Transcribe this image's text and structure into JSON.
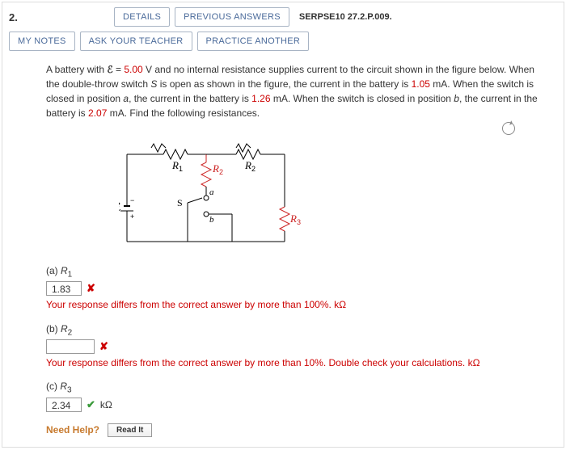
{
  "question_number": "2.",
  "buttons": {
    "details": "DETAILS",
    "previous_answers": "PREVIOUS ANSWERS",
    "my_notes": "MY NOTES",
    "ask_teacher": "ASK YOUR TEACHER",
    "practice_another": "PRACTICE ANOTHER"
  },
  "source_ref": "SERPSE10 27.2.P.009.",
  "problem": {
    "t1": "A battery with ",
    "emf_sym": "ℰ",
    "eq": " = ",
    "emf_val": "5.00",
    "t2": " V and no internal resistance supplies current to the circuit shown in the figure below. When the double-throw switch ",
    "s_sym": "S",
    "t3": " is open as shown in the figure, the current in the battery is ",
    "i_open": "1.05",
    "t4": " mA. When the switch is closed in position ",
    "pos_a": "a",
    "t5": ", the current in the battery is ",
    "i_a": "1.26",
    "t6": " mA. When the switch is closed in position ",
    "pos_b": "b",
    "t7": ", the current in the battery is ",
    "i_b": "2.07",
    "t8": " mA. Find the following resistances."
  },
  "circuit_labels": {
    "R1": "R",
    "R1s": "1",
    "R2": "R",
    "R2s": "2",
    "R2a": "R",
    "R2as": "2",
    "R3": "R",
    "R3s": "3",
    "S": "S",
    "a": "a",
    "b": "b",
    "emf": "ℰ"
  },
  "parts": {
    "a": {
      "label_pre": "(a)   ",
      "label_R": "R",
      "label_sub": "1",
      "answer": "1.83",
      "feedback": "Your response differs from the correct answer by more than 100%. kΩ"
    },
    "b": {
      "label_pre": "(b)   ",
      "label_R": "R",
      "label_sub": "2",
      "answer": "",
      "feedback": "Your response differs from the correct answer by more than 10%. Double check your calculations. kΩ"
    },
    "c": {
      "label_pre": "(c)   ",
      "label_R": "R",
      "label_sub": "3",
      "answer": "2.34",
      "unit": "kΩ"
    }
  },
  "need_help": {
    "label": "Need Help?",
    "readit": "Read It"
  }
}
